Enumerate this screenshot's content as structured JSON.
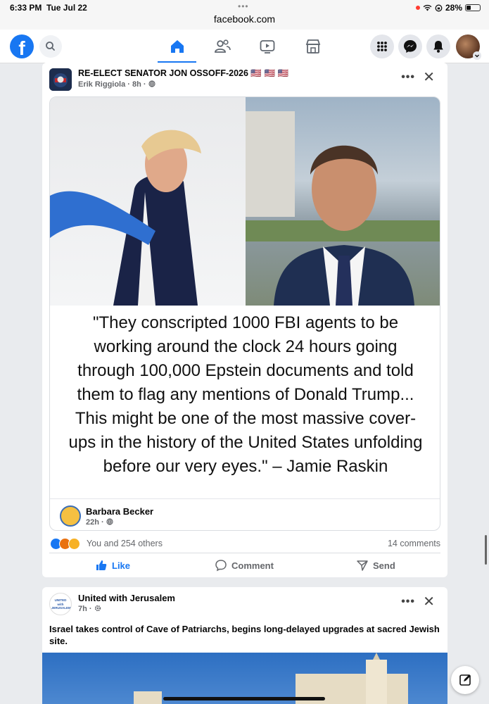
{
  "status_bar": {
    "time": "6:33 PM",
    "date": "Tue Jul 22",
    "dots": "•••",
    "url": "facebook.com",
    "battery": "28%"
  },
  "nav": {
    "logo": "f",
    "icons": [
      "search-icon",
      "home-icon",
      "friends-icon",
      "watch-icon",
      "marketplace-icon",
      "menu-grid-icon",
      "messenger-icon",
      "notifications-icon"
    ],
    "active_tab": "home",
    "accent": "#1877f2"
  },
  "post1": {
    "title": "RE-ELECT SENATOR JON OSSOFF-2026 🇺🇸 🇺🇸 🇺🇸",
    "meta": "Erik Riggiola · 8h · ",
    "more": "•••",
    "close": "✕",
    "quote": "\"They conscripted 1000 FBI agents to be working around the clock 24 hours going through 100,000 Epstein documents and told them to flag any mentions of Donald Trump... This might be one of the most massive cover-ups in the history of the United States unfolding before our very eyes.\"  – Jamie Raskin",
    "sharer_name": "Barbara Becker",
    "sharer_meta": "22h · ",
    "reactions_text": "You and 254 others",
    "comments_count": "14 comments",
    "like_label": "Like",
    "comment_label": "Comment",
    "send_label": "Send"
  },
  "post2": {
    "title": "United with Jerusalem",
    "meta": "7h · ",
    "more": "•••",
    "close": "✕",
    "avatar_text": "UNITED with JERUSALEM",
    "headline": "Israel takes control of Cave of Patriarchs, begins long-delayed upgrades at sacred Jewish site."
  }
}
